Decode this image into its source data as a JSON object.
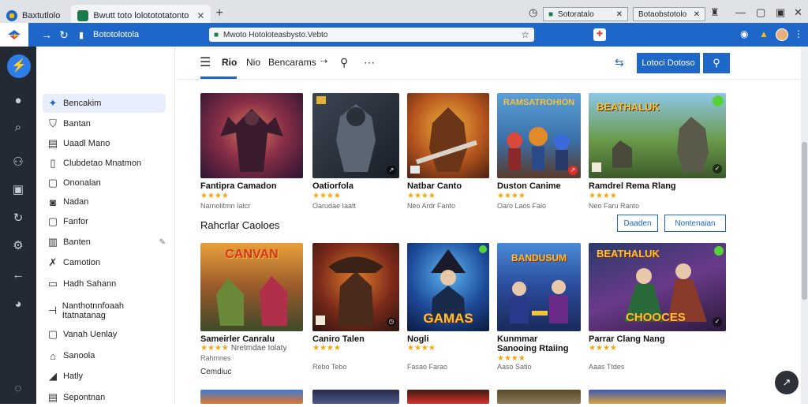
{
  "browser": {
    "tabs": [
      {
        "title": "Baxtutlolo"
      },
      {
        "title": "Bwutt toto lolotototatonto"
      }
    ],
    "pinned": [
      {
        "title": "Sotoratalo"
      },
      {
        "title": "Botaobstotolo"
      }
    ],
    "address": {
      "url": "Mwoto Hotoloteasbysto.Vebto"
    },
    "site_label": "Bototolotola"
  },
  "header": {
    "nav": [
      "Rio",
      "Nio",
      "Bencarams"
    ],
    "primary_button": "Lotoci Dotoso"
  },
  "sidebar": {
    "items": [
      {
        "label": "Bencakim",
        "icon": "star-icon"
      },
      {
        "label": "Bantan",
        "icon": "bookmark-icon"
      },
      {
        "label": "Uaadl Mano",
        "icon": "grid-icon"
      },
      {
        "label": "Clubdetao Mnatmon",
        "icon": "square-icon"
      },
      {
        "label": "Ononalan",
        "icon": "square-icon"
      },
      {
        "label": "Nadan",
        "icon": "circle-icon"
      },
      {
        "label": "Fanfor",
        "icon": "square-icon"
      },
      {
        "label": "Banten",
        "icon": "grid-icon"
      },
      {
        "label": "Camotion",
        "icon": "cross-icon"
      },
      {
        "label": "Hadh Sahann",
        "icon": "bag-icon"
      },
      {
        "label": "Nanthotnnfoaah Itatnatanag",
        "icon": "bracket-icon"
      },
      {
        "label": "Vanah Uenlay",
        "icon": "square-icon"
      },
      {
        "label": "Sanoola",
        "icon": "house-icon"
      },
      {
        "label": "Hatly",
        "icon": "flag-icon"
      },
      {
        "label": "Sepontnan",
        "icon": "grid-icon"
      }
    ]
  },
  "rows": [
    {
      "cards": [
        {
          "title": "Fantipra Camadon",
          "stars": "★★★★",
          "meta": "Narnolitmn Iatcr"
        },
        {
          "title": "Oatiorfola",
          "stars": "★★★★",
          "meta": "Oarudae Iaatt"
        },
        {
          "title": "Natbar Canto",
          "stars": "★★★★",
          "meta": "Neo Ardr Fanto"
        },
        {
          "title": "Duston Canime",
          "stars": "★★★★",
          "meta": "Oaro Laos Falo"
        },
        {
          "title": "Ramdrel Rema Rlang",
          "stars": "★★★★",
          "meta": "Neo Faru Ranto"
        }
      ]
    },
    {
      "cards": [
        {
          "title": "Sameirler Canralu",
          "stars": "★★★★",
          "reviews": "Nretmdae Iolaty",
          "meta": "Rahmnes"
        },
        {
          "title": "Caniro Talen",
          "stars": "★★★★",
          "meta": "Rebo  Tebo"
        },
        {
          "title": "Nogli",
          "stars": "★★★★",
          "meta": "Fasao  Farao"
        },
        {
          "title": "Kunmmar Sanooing Rtaiing",
          "stars": "★★★★",
          "meta": "Aaso  Satio"
        },
        {
          "title": "Parrar Clang Nang",
          "stars": "★★★★",
          "meta": "Aaas  Ttdes"
        }
      ]
    }
  ],
  "section": {
    "title": "Rahcrlar Caoloes",
    "btn_left": "Daaden",
    "btn_right": "Nontenaian",
    "sub_label": "Cemdiuc"
  },
  "thumb_text": {
    "r1c4": "RAMSATROHION",
    "r1c5": "BEATHALUK",
    "r2c1": "CANVAN",
    "r2c3": "GAMAS",
    "r2c4": "BANDUSUM",
    "r2c5": "CHOOCES"
  }
}
